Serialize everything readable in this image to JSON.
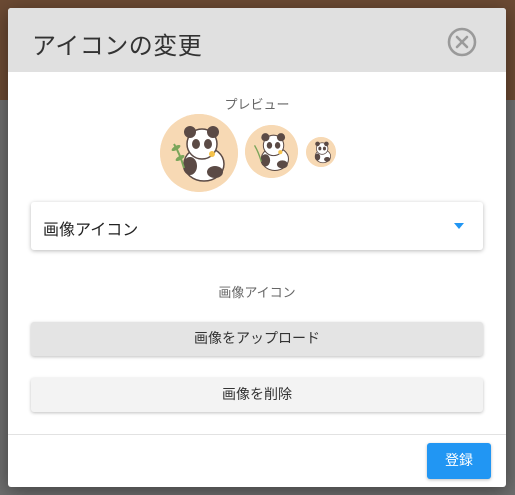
{
  "dialog": {
    "title": "アイコンの変更",
    "close_icon": "close-circle-icon",
    "preview_label": "プレビュー",
    "avatar_icon": "panda-avatar-icon",
    "icon_type_select": {
      "value": "画像アイコン",
      "arrow_icon": "caret-down-icon"
    },
    "section_label": "画像アイコン",
    "upload_button": "画像をアップロード",
    "delete_button": "画像を削除",
    "submit_button": "登録"
  },
  "colors": {
    "accent": "#2196f3",
    "header_bg": "#e0e0e0",
    "avatar_bg": "#f7d9b4"
  }
}
